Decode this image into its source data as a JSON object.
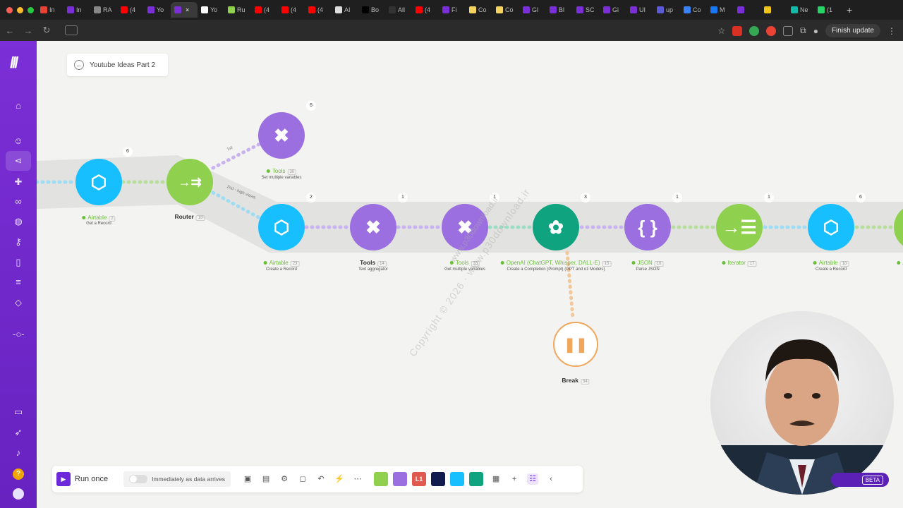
{
  "browser": {
    "tabs": [
      {
        "label": "In",
        "color": "#ea4335"
      },
      {
        "label": "In",
        "color": "#7b2fd6"
      },
      {
        "label": "RA",
        "color": "#888888"
      },
      {
        "label": "(4",
        "color": "#ff0000"
      },
      {
        "label": "Yo",
        "color": "#7b2fd6"
      },
      {
        "label": "",
        "color": "#7b2fd6",
        "active": true
      },
      {
        "label": "Yo",
        "color": "#ffffff"
      },
      {
        "label": "Ru",
        "color": "#8fd14f"
      },
      {
        "label": "(4",
        "color": "#ff0000"
      },
      {
        "label": "(4",
        "color": "#ff0000"
      },
      {
        "label": "(4",
        "color": "#ff0000"
      },
      {
        "label": "AI",
        "color": "#dddddd"
      },
      {
        "label": "Bo",
        "color": "#000000"
      },
      {
        "label": "All",
        "color": "#333333"
      },
      {
        "label": "(4",
        "color": "#ff0000"
      },
      {
        "label": "Fi",
        "color": "#7b2fd6"
      },
      {
        "label": "Co",
        "color": "#f4d35e"
      },
      {
        "label": "Co",
        "color": "#f4d35e"
      },
      {
        "label": "Gl",
        "color": "#7b2fd6"
      },
      {
        "label": "Bl",
        "color": "#7b2fd6"
      },
      {
        "label": "SC",
        "color": "#7b2fd6"
      },
      {
        "label": "Gi",
        "color": "#7b2fd6"
      },
      {
        "label": "UI",
        "color": "#7b2fd6"
      },
      {
        "label": "up",
        "color": "#5b5bd6"
      },
      {
        "label": "Co",
        "color": "#3b82f6"
      },
      {
        "label": "M",
        "color": "#1877f2"
      },
      {
        "label": "",
        "color": "#7b2fd6"
      },
      {
        "label": "",
        "color": "#f0c419"
      },
      {
        "label": "Ne",
        "color": "#14b8a6"
      },
      {
        "label": "(1",
        "color": "#25d366"
      }
    ],
    "finish_update": "Finish update"
  },
  "canvas": {
    "scenario_title": "Youtube Ideas Part 2"
  },
  "nodes": {
    "airtable_get": {
      "name": "Airtable",
      "id": "2",
      "sub": "Get a Record",
      "badge": "6"
    },
    "router": {
      "name": "Router",
      "id": "10"
    },
    "tools_top": {
      "name": "Tools",
      "id": "30",
      "sub": "Set multiple variables",
      "badge": "6"
    },
    "airtable_create": {
      "name": "Airtable",
      "id": "23",
      "sub": "Create a Record",
      "badge": "2"
    },
    "tools_text": {
      "name": "Tools",
      "id": "14",
      "sub": "Text aggregator",
      "badge": "1"
    },
    "tools_vars": {
      "name": "Tools",
      "id": "33",
      "sub": "Get multiple variables",
      "badge": "1"
    },
    "openai": {
      "name": "OpenAI (ChatGPT, Whisper, DALL-E)",
      "id": "15",
      "sub": "Create a Completion (Prompt) (GPT and o1 Models)",
      "badge": "3"
    },
    "json": {
      "name": "JSON",
      "id": "16",
      "sub": "Parse JSON",
      "badge": "1"
    },
    "iterator": {
      "name": "Iterator",
      "id": "17",
      "badge": "1"
    },
    "airtable_create2": {
      "name": "Airtable",
      "id": "18",
      "sub": "Create a Record",
      "badge": "6"
    },
    "break": {
      "name": "Break",
      "id": "34"
    },
    "route_tag_1": "1st",
    "route_tag_2": "2nd - high views",
    "edge_label": "A"
  },
  "toolbar": {
    "run_once": "Run once",
    "schedule": "Immediately as data arrives",
    "apps": [
      {
        "name": "router-app-icon",
        "color": "#8fd14f"
      },
      {
        "name": "tools-app-icon",
        "color": "#9c6fe0"
      },
      {
        "name": "flow-control-app-icon",
        "color": "#e05a4f",
        "text": "L1"
      },
      {
        "name": "make-app-icon",
        "color": "#111b4d"
      },
      {
        "name": "airtable-app-icon",
        "color": "#18bfff"
      },
      {
        "name": "openai-app-icon",
        "color": "#10a37f"
      }
    ]
  },
  "overlays": {
    "watermark": "Copyright © 2026 · www.p30download.ir",
    "watermark2": "www.p30download.ir",
    "beta": "BETA"
  }
}
